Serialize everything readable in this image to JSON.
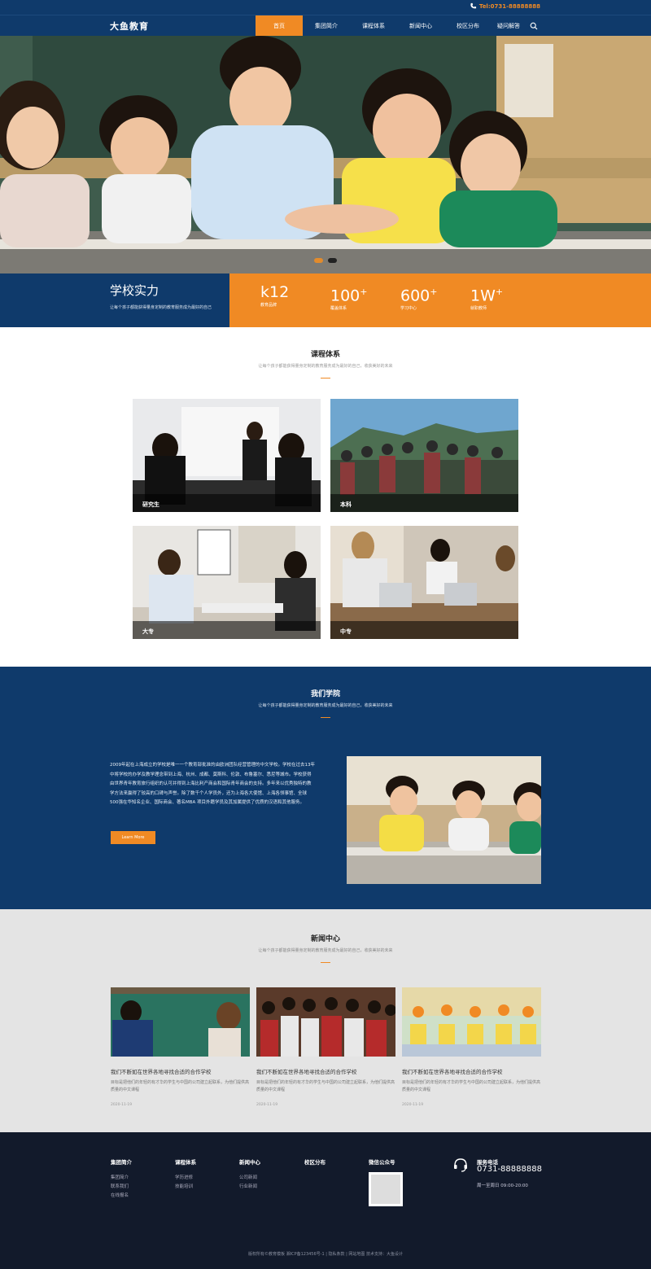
{
  "topbar": {
    "phone": "Tel:0731-88888888"
  },
  "header": {
    "logo": "大鱼教育",
    "nav": [
      "首页",
      "集团简介",
      "课程体系",
      "新闻中心",
      "校区分布",
      "疑问解答"
    ]
  },
  "strength": {
    "title": "学校实力",
    "subtitle": "让每个孩子都能获得量身定制的教育服务成为最好的自己",
    "stats": [
      {
        "value": "k12",
        "suffix": "",
        "label": "教育品牌"
      },
      {
        "value": "100",
        "suffix": "+",
        "label": "覆盖体系"
      },
      {
        "value": "600",
        "suffix": "+",
        "label": "学习中心"
      },
      {
        "value": "1W",
        "suffix": "+",
        "label": "就职教师"
      }
    ]
  },
  "courses": {
    "title": "课程体系",
    "subtitle": "让每个孩子都能获得量身定制的教育服务成为最好的自己，收获美好的未来",
    "items": [
      "研究生",
      "本科",
      "大专",
      "中专"
    ]
  },
  "about": {
    "title": "我们学院",
    "subtitle": "让每个孩子都能获得量身定制的教育服务成为最好的自己，收获美好的未来",
    "text": "2009年起在上海成立的学校是唯一一个教育部批准的由欧洲团队经营管理的中文学校。学校在过去13年中将学校的办学及教学理念带到上海、杭州、成都、莫斯科、伦敦、布鲁塞尔、悉尼等城市。学校获得由世界青年教育旅行组织的认可并得到上海比利产商会和国际青年商会的支持。多年来以优秀独特的教学方法来赢得了较高的口碑与声誉。除了数千个人学员外，还为上海各大使馆、上海各领事馆、全球500强在华知名企业、国际商会、著名MBA 项目外籍学员及其加属提供了优质的汉语和其他服务。",
    "button": "Learn More"
  },
  "news": {
    "title": "新闻中心",
    "subtitle": "让每个孩子都能获得量身定制的教育服务成为最好的自己，收获美好的未来",
    "items": [
      {
        "title": "我们不断如在世界各地寻找合适的合作学校",
        "desc": "目标是把他们的年轻的有才华的学生与中国的公司建立起联系，为他们提供高质量的中文课程",
        "date": "2020-11-19"
      },
      {
        "title": "我们不断如在世界各地寻找合适的合作学校",
        "desc": "目标是把他们的年轻的有才华的学生与中国的公司建立起联系，为他们提供高质量的中文课程",
        "date": "2020-11-19"
      },
      {
        "title": "我们不断如在世界各地寻找合适的合作学校",
        "desc": "目标是把他们的年轻的有才华的学生与中国的公司建立起联系，为他们提供高质量的中文课程",
        "date": "2020-11-19"
      }
    ]
  },
  "footer": {
    "cols": [
      {
        "title": "集团简介",
        "links": [
          "集团简介",
          "联系我们",
          "在线报名"
        ]
      },
      {
        "title": "课程体系",
        "links": [
          "学历进修",
          "技能培训"
        ]
      },
      {
        "title": "新闻中心",
        "links": [
          "公司新闻",
          "行业新闻"
        ]
      },
      {
        "title": "校区分布",
        "links": []
      },
      {
        "title": "微信公众号",
        "links": []
      }
    ],
    "service_title": "服务电话",
    "service_phone": "0731-88888888",
    "service_hours": "周一至周日 09:00-20:00",
    "copyright": "版权所有©教育模板  湘ICP备123456号-1  |  隐私条款  |  网站地图  技术支持：大鱼设计"
  },
  "colors": {
    "navy": "#0f3a6b",
    "orange": "#f08a24",
    "footer": "#121a2b"
  }
}
